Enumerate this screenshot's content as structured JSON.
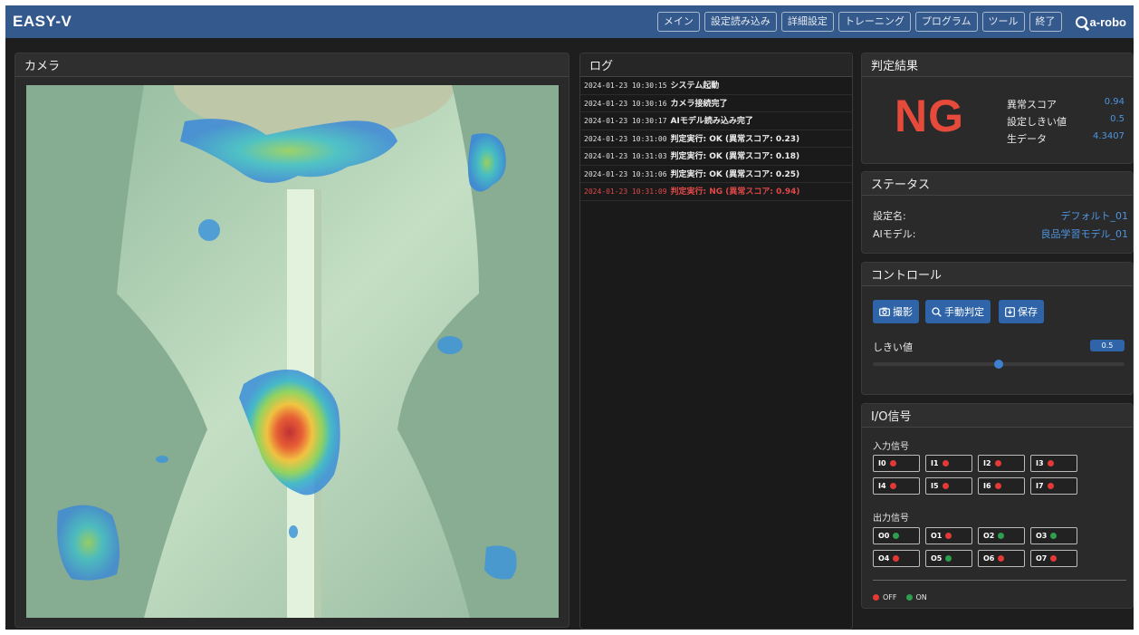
{
  "app": {
    "title": "EASY-V",
    "brand": "a-robo"
  },
  "nav": [
    "メイン",
    "設定読み込み",
    "詳細設定",
    "トレーニング",
    "プログラム",
    "ツール",
    "終了"
  ],
  "camera": {
    "title": "カメラ"
  },
  "log": {
    "title": "ログ",
    "entries": [
      {
        "ts": "2024-01-23 10:30:15",
        "msg": "システム起動",
        "level": "info"
      },
      {
        "ts": "2024-01-23 10:30:16",
        "msg": "カメラ接続完了",
        "level": "info"
      },
      {
        "ts": "2024-01-23 10:30:17",
        "msg": "AIモデル読み込み完了",
        "level": "info"
      },
      {
        "ts": "2024-01-23 10:31:00",
        "msg": "判定実行: OK (異常スコア: 0.23)",
        "level": "info"
      },
      {
        "ts": "2024-01-23 10:31:03",
        "msg": "判定実行: OK (異常スコア: 0.18)",
        "level": "info"
      },
      {
        "ts": "2024-01-23 10:31:06",
        "msg": "判定実行: OK (異常スコア: 0.25)",
        "level": "info"
      },
      {
        "ts": "2024-01-23 10:31:09",
        "msg": "判定実行: NG (異常スコア: 0.94)",
        "level": "ng"
      }
    ]
  },
  "result": {
    "title": "判定結果",
    "verdict": "NG",
    "rows": [
      {
        "label": "異常スコア",
        "value": "0.94"
      },
      {
        "label": "設定しきい値",
        "value": "0.5"
      },
      {
        "label": "生データ",
        "value": "4.3407"
      }
    ]
  },
  "status": {
    "title": "ステータス",
    "rows": [
      {
        "label": "設定名:",
        "value": "デフォルト_01"
      },
      {
        "label": "AIモデル:",
        "value": "良品学習モデル_01"
      }
    ]
  },
  "control": {
    "title": "コントロール",
    "capture_label": "撮影",
    "judge_label": "手動判定",
    "save_label": "保存",
    "threshold_label": "しきい値",
    "threshold_value": "0.5",
    "threshold_fraction": 0.5
  },
  "io": {
    "title": "I/O信号",
    "input_label": "入力信号",
    "output_label": "出力信号",
    "inputs": [
      {
        "name": "I0",
        "state": "off"
      },
      {
        "name": "I1",
        "state": "off"
      },
      {
        "name": "I2",
        "state": "off"
      },
      {
        "name": "I3",
        "state": "off"
      },
      {
        "name": "I4",
        "state": "off"
      },
      {
        "name": "I5",
        "state": "off"
      },
      {
        "name": "I6",
        "state": "off"
      },
      {
        "name": "I7",
        "state": "off"
      }
    ],
    "outputs": [
      {
        "name": "O0",
        "state": "on"
      },
      {
        "name": "O1",
        "state": "off"
      },
      {
        "name": "O2",
        "state": "on"
      },
      {
        "name": "O3",
        "state": "on"
      },
      {
        "name": "O4",
        "state": "off"
      },
      {
        "name": "O5",
        "state": "on"
      },
      {
        "name": "O6",
        "state": "off"
      },
      {
        "name": "O7",
        "state": "off"
      }
    ],
    "legend_off": "OFF",
    "legend_on": "ON"
  },
  "colors": {
    "off": "#e53935",
    "on": "#2e9e4f",
    "accent": "#2f65a8",
    "ng": "#e64a3b",
    "header": "#34598d"
  }
}
